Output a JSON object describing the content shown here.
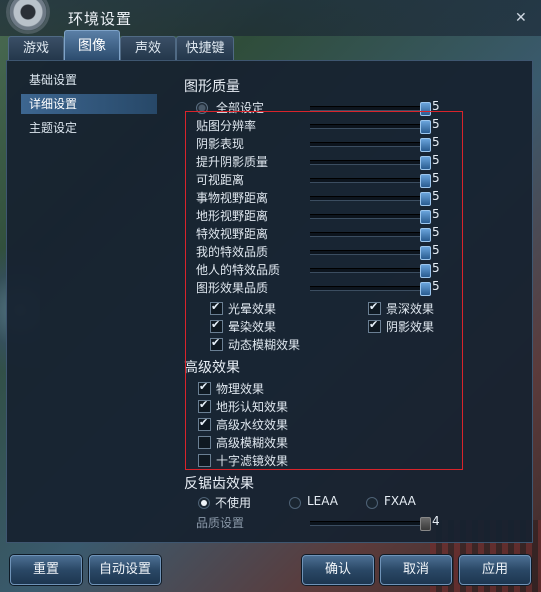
{
  "window": {
    "title": "环境设置"
  },
  "tabs": [
    {
      "label": "游戏"
    },
    {
      "label": "图像"
    },
    {
      "label": "声效"
    },
    {
      "label": "快捷键"
    }
  ],
  "sidebar": {
    "items": [
      {
        "label": "基础设置"
      },
      {
        "label": "详细设置"
      },
      {
        "label": "主题设定"
      }
    ]
  },
  "graphics_quality": {
    "title": "图形质量",
    "all_setting": {
      "label": "全部设定",
      "value": "5"
    },
    "sliders": [
      {
        "label": "贴图分辨率",
        "value": "5"
      },
      {
        "label": "阴影表现",
        "value": "5"
      },
      {
        "label": "提升阴影质量",
        "value": "5"
      },
      {
        "label": "可视距离",
        "value": "5"
      },
      {
        "label": "事物视野距离",
        "value": "5"
      },
      {
        "label": "地形视野距离",
        "value": "5"
      },
      {
        "label": "特效视野距离",
        "value": "5"
      },
      {
        "label": "我的特效品质",
        "value": "5"
      },
      {
        "label": "他人的特效品质",
        "value": "5"
      },
      {
        "label": "图形效果品质",
        "value": "5"
      }
    ],
    "effects": [
      {
        "label": "光晕效果",
        "checked": true
      },
      {
        "label": "景深效果",
        "checked": true
      },
      {
        "label": "晕染效果",
        "checked": true
      },
      {
        "label": "阴影效果",
        "checked": true
      },
      {
        "label": "动态模糊效果",
        "checked": true
      }
    ]
  },
  "advanced": {
    "title": "高级效果",
    "items": [
      {
        "label": "物理效果",
        "checked": true
      },
      {
        "label": "地形认知效果",
        "checked": true
      },
      {
        "label": "高级水纹效果",
        "checked": true
      },
      {
        "label": "高级模糊效果",
        "checked": false
      },
      {
        "label": "十字滤镜效果",
        "checked": false
      }
    ]
  },
  "antialias": {
    "title": "反锯齿效果",
    "options": [
      {
        "label": "不使用",
        "selected": true
      },
      {
        "label": "LEAA",
        "selected": false
      },
      {
        "label": "FXAA",
        "selected": false
      }
    ],
    "quality": {
      "label": "品质设置",
      "value": "4"
    }
  },
  "buttons": {
    "reset": "重置",
    "auto": "自动设置",
    "confirm": "确认",
    "cancel": "取消",
    "apply": "应用"
  },
  "colors": {
    "panel_bg": "#16222f",
    "accent": "#3d6690",
    "highlight_box": "#d8242b"
  }
}
